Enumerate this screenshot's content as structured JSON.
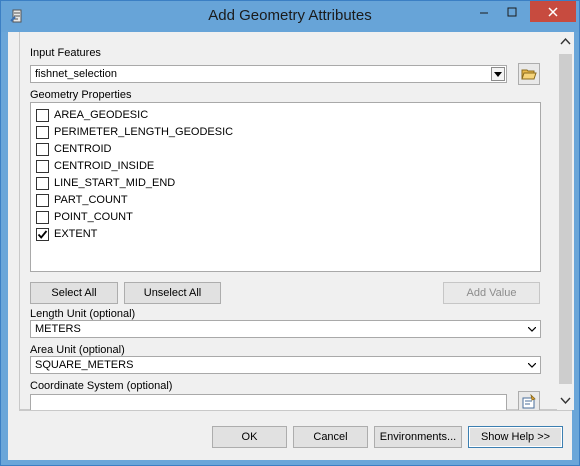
{
  "window": {
    "title": "Add Geometry Attributes"
  },
  "form": {
    "input_features_label": "Input Features",
    "input_features_value": "fishnet_selection",
    "geometry_properties_label": "Geometry Properties",
    "properties": [
      {
        "label": "AREA_GEODESIC",
        "checked": false
      },
      {
        "label": "PERIMETER_LENGTH_GEODESIC",
        "checked": false
      },
      {
        "label": "CENTROID",
        "checked": false
      },
      {
        "label": "CENTROID_INSIDE",
        "checked": false
      },
      {
        "label": "LINE_START_MID_END",
        "checked": false
      },
      {
        "label": "PART_COUNT",
        "checked": false
      },
      {
        "label": "POINT_COUNT",
        "checked": false
      },
      {
        "label": "EXTENT",
        "checked": true
      }
    ],
    "select_all_label": "Select All",
    "unselect_all_label": "Unselect All",
    "add_value_label": "Add Value",
    "length_unit_label": "Length Unit (optional)",
    "length_unit_value": "METERS",
    "area_unit_label": "Area Unit (optional)",
    "area_unit_value": "SQUARE_METERS",
    "coordinate_system_label": "Coordinate System (optional)",
    "coordinate_system_value": ""
  },
  "footer": {
    "ok_label": "OK",
    "cancel_label": "Cancel",
    "environments_label": "Environments...",
    "show_help_label": "Show Help >>"
  },
  "colors": {
    "titlebar": "#67a4d8",
    "close_button": "#c74b3f"
  }
}
